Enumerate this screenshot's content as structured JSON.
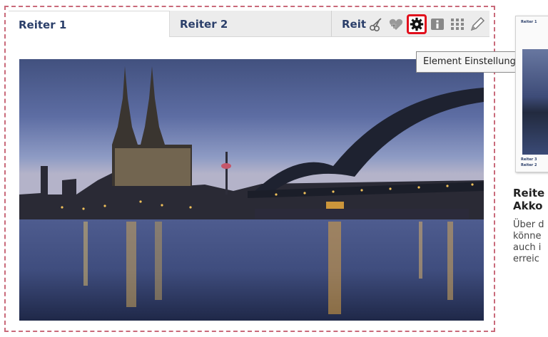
{
  "tabs": [
    {
      "label": "Reiter 1",
      "active": true
    },
    {
      "label": "Reiter 2",
      "active": false
    },
    {
      "label": "Reit",
      "active": false
    }
  ],
  "toolbar": {
    "items": [
      {
        "icon": "scissors-icon"
      },
      {
        "icon": "add-favorite-icon"
      },
      {
        "icon": "gear-icon",
        "highlighted": true
      },
      {
        "icon": "info-icon"
      },
      {
        "icon": "grid-icon"
      },
      {
        "icon": "pencil-icon"
      }
    ],
    "tooltip": "Element Einstellungen",
    "highlight_color": "#e10f1c"
  },
  "image": {
    "description_icon": "cologne-cathedral-photo"
  },
  "sidebar": {
    "thumb_labels": [
      "Reiter 1",
      "Reiter 3",
      "Reiter 2"
    ],
    "title_lines": [
      "Reite",
      "Akko"
    ],
    "text_lines": [
      "Über d",
      "könne",
      "auch i",
      "erreic"
    ]
  },
  "colors": {
    "frame_border": "#c96a7a",
    "tab_text": "#2b3f6a"
  }
}
